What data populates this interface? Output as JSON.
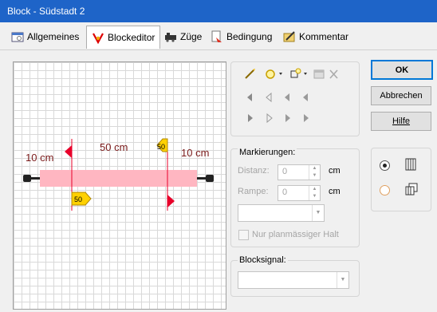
{
  "window": {
    "title": "Block - Südstadt 2"
  },
  "tabs": [
    {
      "label": "Allgemeines",
      "active": false
    },
    {
      "label": "Blockeditor",
      "active": true
    },
    {
      "label": "Züge",
      "active": false
    },
    {
      "label": "Bedingung",
      "active": false
    },
    {
      "label": "Kommentar",
      "active": false
    }
  ],
  "canvas": {
    "length_label": "50 cm",
    "left_label": "10 cm",
    "right_label": "10 cm",
    "speed_marker_top": "50",
    "speed_marker_bottom": "50"
  },
  "markings": {
    "title": "Markierungen:",
    "distance_label": "Distanz:",
    "distance_value": "0",
    "ramp_label": "Rampe:",
    "ramp_value": "0",
    "unit": "cm",
    "scheduled_stop_label": "Nur planmässiger Halt"
  },
  "block_signal": {
    "title": "Blocksignal:"
  },
  "buttons": {
    "ok": "OK",
    "cancel": "Abbrechen",
    "help": "Hilfe"
  },
  "colors": {
    "titlebar": "#1e64c8",
    "block": "#ffb6c1",
    "arrow": "#e8002a",
    "speed": "#ffd100"
  }
}
